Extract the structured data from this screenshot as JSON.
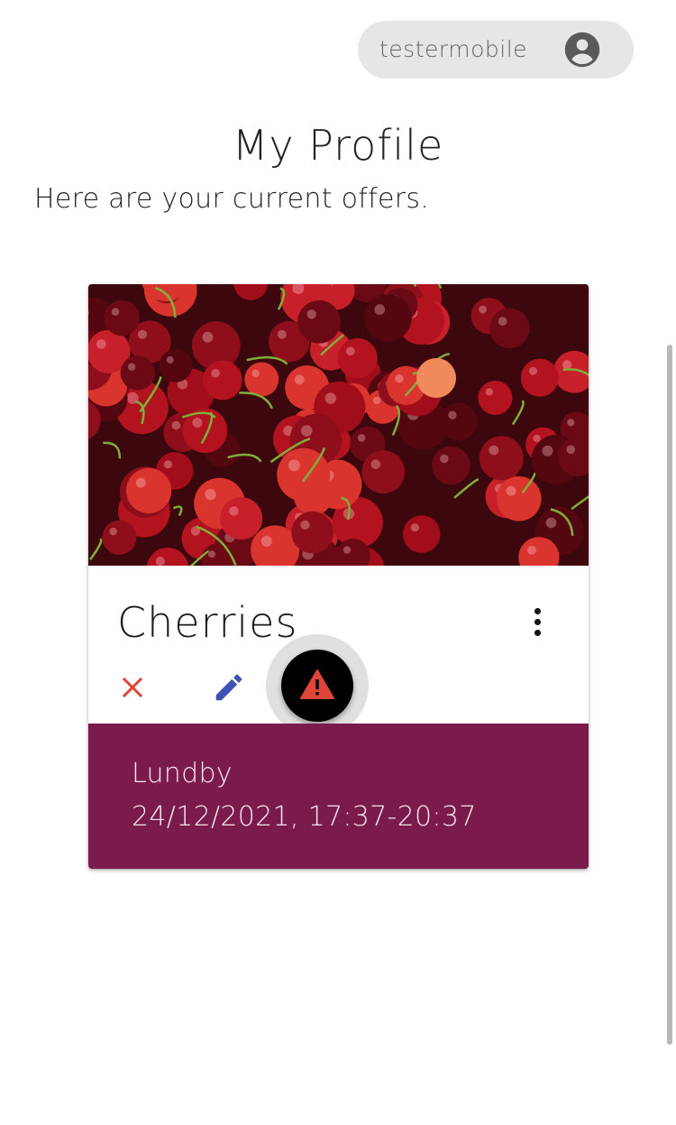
{
  "header": {
    "username": "testermobile",
    "avatar_icon": "account-circle-icon"
  },
  "profile": {
    "title": "My Profile",
    "subtitle": "Here are your current offers."
  },
  "offer": {
    "title": "Cherries",
    "image_icon": "cherries-photo",
    "location": "Lundby",
    "time": "24/12/2021, 17:37-20:37",
    "actions": {
      "more_icon": "more-vert-icon",
      "delete_icon": "close-icon",
      "edit_icon": "pencil-icon",
      "report_icon": "warning-icon"
    }
  },
  "colors": {
    "footer": "#7b1b4b",
    "delete": "#e0453a",
    "edit": "#3f51b5",
    "warning": "#e0453a",
    "chip": "#e6e6e6"
  }
}
